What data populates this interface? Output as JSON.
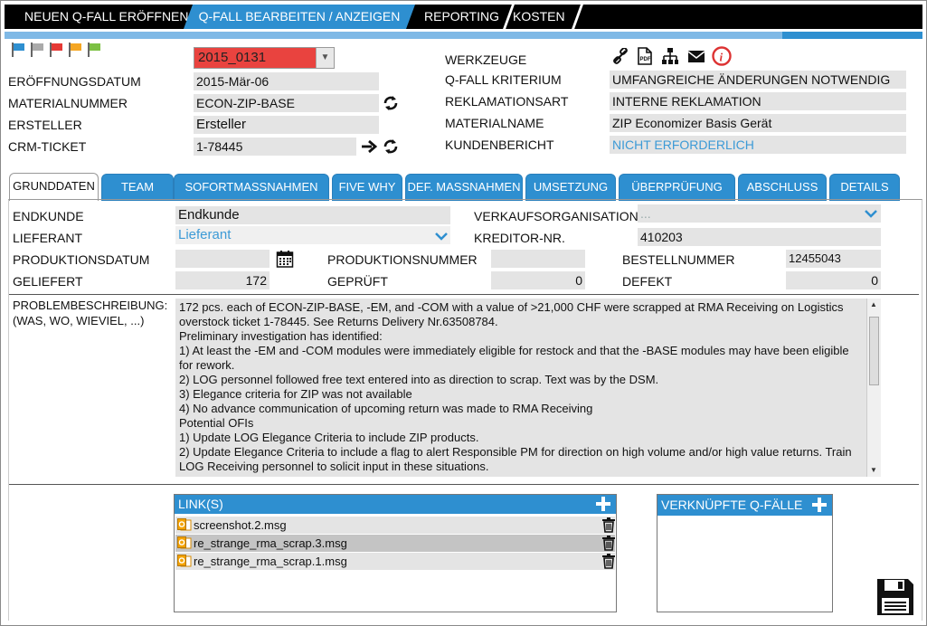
{
  "nav": {
    "items": [
      "NEUEN Q-FALL ERÖFFNEN",
      "Q-FALL BEARBEITEN / ANZEIGEN",
      "REPORTING",
      "KOSTEN"
    ],
    "active_index": 1
  },
  "header": {
    "flags": [
      "#2e8fd0",
      "#aaaaaa",
      "#e53935",
      "#f5a623",
      "#7cc043"
    ],
    "case_select": "2015_0131",
    "left": {
      "eroeffnungsdatum_label": "ERÖFFNUNGSDATUM",
      "eroeffnungsdatum_value": "2015-Mär-06",
      "materialnummer_label": "MATERIALNUMMER",
      "materialnummer_value": "ECON-ZIP-BASE",
      "ersteller_label": "ERSTELLER",
      "ersteller_value": "Ersteller",
      "crm_label": "CRM-TICKET",
      "crm_value": "1-78445"
    },
    "right": {
      "werkzeuge_label": "WERKZEUGE",
      "kriterium_label": "Q-FALL KRITERIUM",
      "kriterium_value": "UMFANGREICHE ÄNDERUNGEN NOTWENDIG",
      "reklamationsart_label": "REKLAMATIONSART",
      "reklamationsart_value": "INTERNE REKLAMATION",
      "materialname_label": "MATERIALNAME",
      "materialname_value": "ZIP Economizer Basis Gerät",
      "kundenbericht_label": "KUNDENBERICHT",
      "kundenbericht_value": "NICHT ERFORDERLICH"
    }
  },
  "tabs": [
    "GRUNDDATEN",
    "TEAM",
    "SOFORTMASSNAHMEN",
    "FIVE WHY",
    "DEF. MASSNAHMEN",
    "UMSETZUNG",
    "ÜBERPRÜFUNG",
    "ABSCHLUSS",
    "DETAILS"
  ],
  "grunddaten": {
    "endkunde_label": "ENDKUNDE",
    "endkunde_value": "Endkunde",
    "lieferant_label": "LIEFERANT",
    "lieferant_value": "Lieferant",
    "verkaufsorg_label": "VERKAUFSORGANISATION",
    "verkaufsorg_value": "...",
    "kreditor_label": "KREDITOR-NR.",
    "kreditor_value": "410203",
    "produktionsdatum_label": "PRODUKTIONSDATUM",
    "produktionsnummer_label": "PRODUKTIONSNUMMER",
    "bestellnummer_label": "BESTELLNUMMER",
    "bestellnummer_value": "12455043",
    "geliefert_label": "GELIEFERT",
    "geliefert_value": "172",
    "geprueft_label": "GEPRÜFT",
    "geprueft_value": "0",
    "defekt_label": "DEFEKT",
    "defekt_value": "0",
    "problem_label_1": "PROBLEMBESCHREIBUNG:",
    "problem_label_2": "(WAS, WO, WIEVIEL, ...)",
    "problem_lines": [
      "172 pcs. each of ECON-ZIP-BASE, -EM, and -COM with a value of >21,000 CHF were scrapped at RMA Receiving on Logistics",
      "overstock ticket 1-78445. See Returns Delivery Nr.63508784.",
      "Preliminary investigation has identified:",
      "1) At least the -EM and -COM modules were immediately eligible for restock and that the -BASE modules may have been eligible",
      "for rework.",
      "2) LOG personnel followed free text entered into as direction to scrap. Text was by the DSM.",
      "3) Elegance criteria for ZIP was not available",
      "4) No advance communication of upcoming return was made to RMA Receiving",
      "Potential OFIs",
      "1) Update LOG Elegance Criteria to include ZIP products.",
      "2) Update Elegance Criteria to include a flag to alert Responsible PM for direction on high volume and/or high value returns. Train",
      "LOG Receiving personnel to solicit input in these situations."
    ]
  },
  "links": {
    "title": "LINK(S)",
    "files": [
      "screenshot.2.msg",
      "re_strange_rma_scrap.3.msg",
      "re_strange_rma_scrap.1.msg"
    ]
  },
  "related": {
    "title": "VERKNÜPFTE Q-FÄLLE"
  }
}
